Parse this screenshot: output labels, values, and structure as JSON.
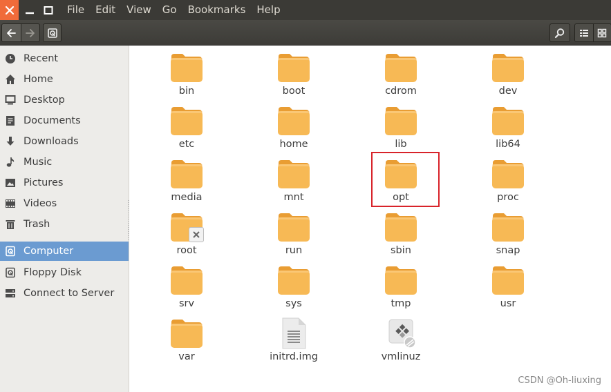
{
  "window": {
    "close_icon": "close-icon",
    "minimize_icon": "minimize-icon",
    "maximize_icon": "maximize-icon"
  },
  "menubar": {
    "items": [
      "File",
      "Edit",
      "View",
      "Go",
      "Bookmarks",
      "Help"
    ]
  },
  "toolbar": {
    "back_icon": "arrow-left-icon",
    "forward_icon": "arrow-right-icon",
    "location_icon": "drive-icon",
    "search_icon": "search-icon",
    "list_view_icon": "list-view-icon",
    "grid_view_icon": "grid-view-icon"
  },
  "sidebar": {
    "items": [
      {
        "label": "Recent",
        "icon": "clock-icon"
      },
      {
        "label": "Home",
        "icon": "home-icon"
      },
      {
        "label": "Desktop",
        "icon": "desktop-icon"
      },
      {
        "label": "Documents",
        "icon": "document-icon"
      },
      {
        "label": "Downloads",
        "icon": "download-icon"
      },
      {
        "label": "Music",
        "icon": "music-icon"
      },
      {
        "label": "Pictures",
        "icon": "picture-icon"
      },
      {
        "label": "Videos",
        "icon": "video-icon"
      },
      {
        "label": "Trash",
        "icon": "trash-icon"
      },
      {
        "label": "Computer",
        "icon": "computer-icon",
        "active": true
      },
      {
        "label": "Floppy Disk",
        "icon": "floppy-icon"
      },
      {
        "label": "Connect to Server",
        "icon": "server-icon"
      }
    ]
  },
  "files": [
    {
      "name": "bin",
      "type": "folder"
    },
    {
      "name": "boot",
      "type": "folder"
    },
    {
      "name": "cdrom",
      "type": "folder"
    },
    {
      "name": "dev",
      "type": "folder"
    },
    {
      "name": "etc",
      "type": "folder"
    },
    {
      "name": "home",
      "type": "folder"
    },
    {
      "name": "lib",
      "type": "folder"
    },
    {
      "name": "lib64",
      "type": "folder"
    },
    {
      "name": "media",
      "type": "folder"
    },
    {
      "name": "mnt",
      "type": "folder"
    },
    {
      "name": "opt",
      "type": "folder",
      "highlighted": true
    },
    {
      "name": "proc",
      "type": "folder"
    },
    {
      "name": "root",
      "type": "folder-locked"
    },
    {
      "name": "run",
      "type": "folder"
    },
    {
      "name": "sbin",
      "type": "folder"
    },
    {
      "name": "snap",
      "type": "folder"
    },
    {
      "name": "srv",
      "type": "folder"
    },
    {
      "name": "sys",
      "type": "folder"
    },
    {
      "name": "tmp",
      "type": "folder"
    },
    {
      "name": "usr",
      "type": "folder"
    },
    {
      "name": "var",
      "type": "folder"
    },
    {
      "name": "initrd.img",
      "type": "text-file"
    },
    {
      "name": "vmlinuz",
      "type": "binary-file"
    }
  ],
  "colors": {
    "accent": "#6b9bd1",
    "folder": "#f7b955",
    "folder_dark": "#e99d33",
    "close": "#f06b3a",
    "highlight": "#d8232a"
  },
  "watermark": "CSDN @Oh-liuxing"
}
